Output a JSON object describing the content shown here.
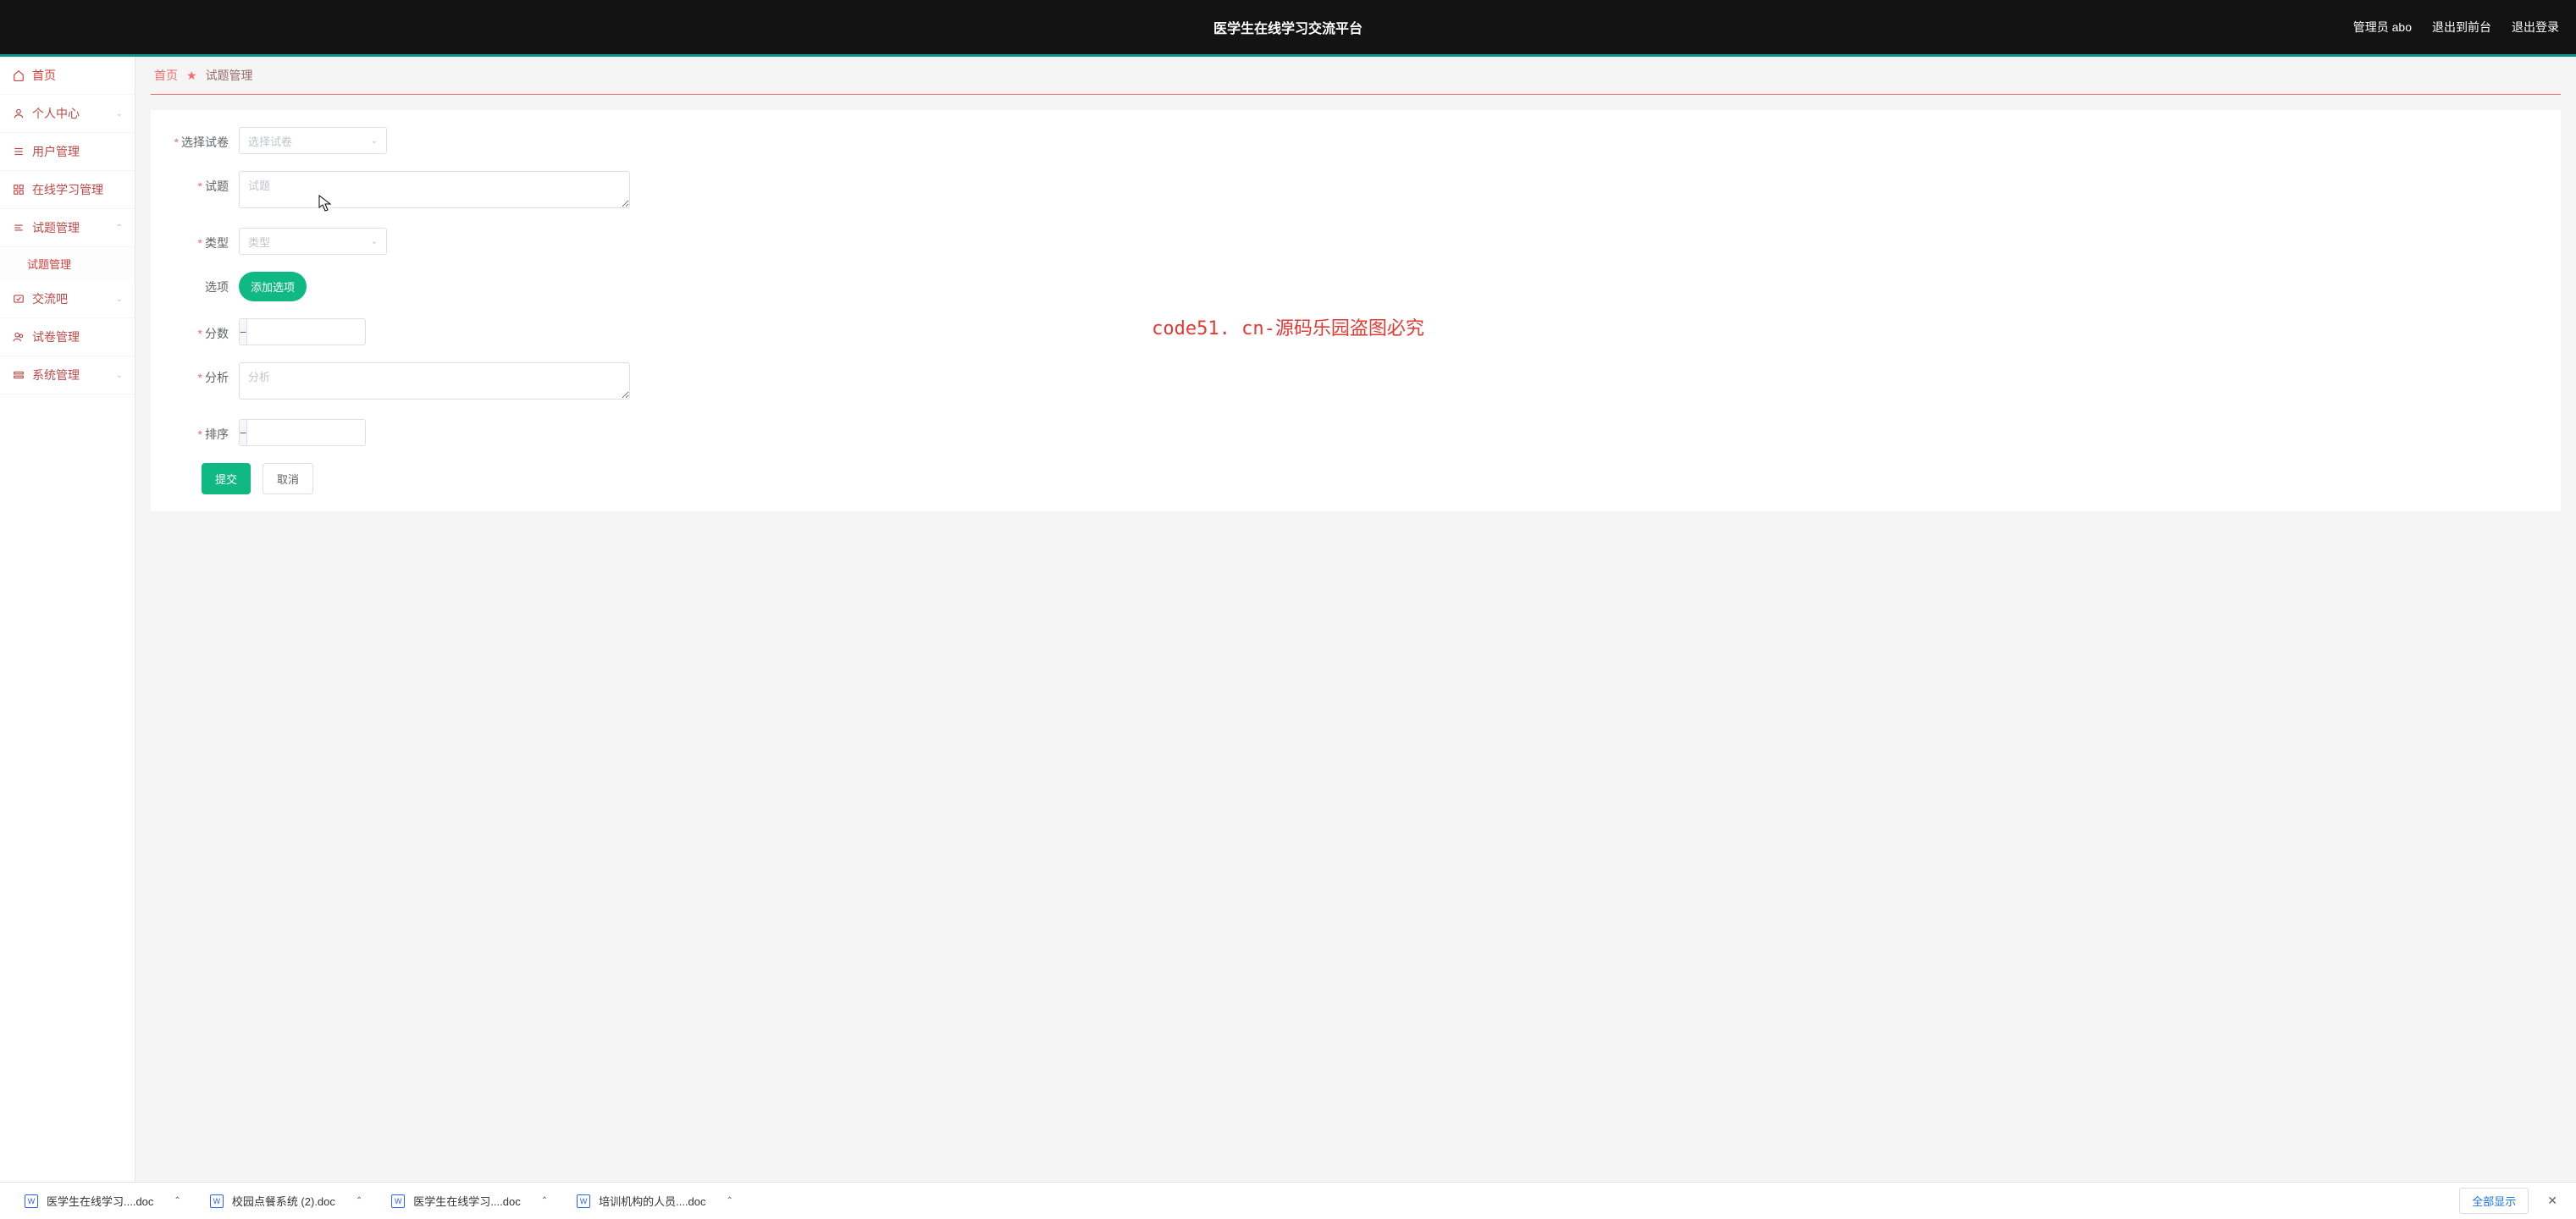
{
  "topbar": {
    "title": "医学生在线学习交流平台",
    "user_label": "管理员 abo",
    "exit_front": "退出到前台",
    "logout": "退出登录"
  },
  "sidebar": {
    "home": "首页",
    "items": [
      {
        "label": "个人中心",
        "icon": "user"
      },
      {
        "label": "用户管理",
        "icon": "list"
      },
      {
        "label": "在线学习管理",
        "icon": "grid"
      },
      {
        "label": "试题管理",
        "icon": "bars",
        "expanded": true,
        "sub": "试题管理"
      },
      {
        "label": "交流吧",
        "icon": "check"
      },
      {
        "label": "试卷管理",
        "icon": "users"
      },
      {
        "label": "系统管理",
        "icon": "settings"
      }
    ]
  },
  "breadcrumb": {
    "home": "首页",
    "current": "试题管理"
  },
  "form": {
    "select_exam": {
      "label": "选择试卷",
      "placeholder": "选择试卷"
    },
    "question": {
      "label": "试题",
      "placeholder": "试题"
    },
    "type": {
      "label": "类型",
      "placeholder": "类型"
    },
    "options": {
      "label": "选项",
      "add_btn": "添加选项"
    },
    "score": {
      "label": "分数"
    },
    "analysis": {
      "label": "分析",
      "placeholder": "分析"
    },
    "sort": {
      "label": "排序"
    },
    "submit": "提交",
    "cancel": "取消"
  },
  "watermark": "code51. cn-源码乐园盗图必究",
  "downloads": {
    "items": [
      "医学生在线学习....doc",
      "校园点餐系统 (2).doc",
      "医学生在线学习....doc",
      "培训机构的人员....doc"
    ],
    "show_all": "全部显示"
  }
}
